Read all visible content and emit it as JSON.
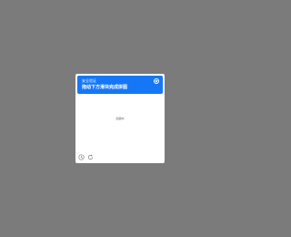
{
  "captcha": {
    "subtitle": "安全验证",
    "title": "拖动下方滑块完成拼图",
    "loading_text": "加载中",
    "header_color": "#1677f6",
    "icons": {
      "close": "close-icon",
      "help": "help-icon",
      "refresh": "refresh-icon"
    }
  }
}
